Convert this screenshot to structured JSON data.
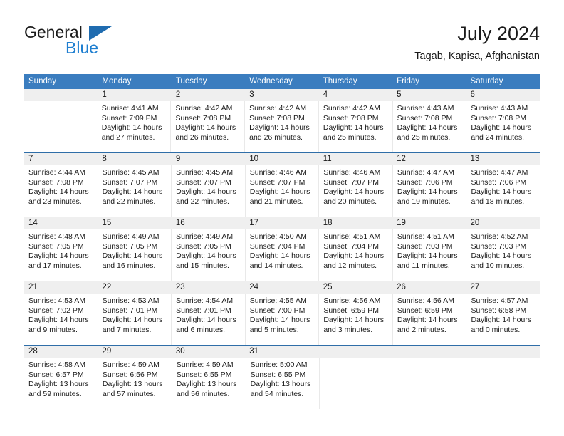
{
  "brand": {
    "name_dark": "General",
    "name_light": "Blue",
    "triangle_color": "#1f6cb0",
    "blue_text_color": "#1f7fd0"
  },
  "header": {
    "title": "July 2024",
    "subtitle": "Tagab, Kapisa, Afghanistan"
  },
  "theme": {
    "header_bg": "#3b7dbf",
    "header_text": "#ffffff",
    "daynum_bg": "#efefef",
    "separator": "#2f6ea8",
    "cell_border": "#e9e9e9"
  },
  "weekdays": [
    "Sunday",
    "Monday",
    "Tuesday",
    "Wednesday",
    "Thursday",
    "Friday",
    "Saturday"
  ],
  "weeks": [
    {
      "days": [
        {
          "num": "",
          "lines": []
        },
        {
          "num": "1",
          "lines": [
            "Sunrise: 4:41 AM",
            "Sunset: 7:09 PM",
            "Daylight: 14 hours",
            "and 27 minutes."
          ]
        },
        {
          "num": "2",
          "lines": [
            "Sunrise: 4:42 AM",
            "Sunset: 7:08 PM",
            "Daylight: 14 hours",
            "and 26 minutes."
          ]
        },
        {
          "num": "3",
          "lines": [
            "Sunrise: 4:42 AM",
            "Sunset: 7:08 PM",
            "Daylight: 14 hours",
            "and 26 minutes."
          ]
        },
        {
          "num": "4",
          "lines": [
            "Sunrise: 4:42 AM",
            "Sunset: 7:08 PM",
            "Daylight: 14 hours",
            "and 25 minutes."
          ]
        },
        {
          "num": "5",
          "lines": [
            "Sunrise: 4:43 AM",
            "Sunset: 7:08 PM",
            "Daylight: 14 hours",
            "and 25 minutes."
          ]
        },
        {
          "num": "6",
          "lines": [
            "Sunrise: 4:43 AM",
            "Sunset: 7:08 PM",
            "Daylight: 14 hours",
            "and 24 minutes."
          ]
        }
      ]
    },
    {
      "days": [
        {
          "num": "7",
          "lines": [
            "Sunrise: 4:44 AM",
            "Sunset: 7:08 PM",
            "Daylight: 14 hours",
            "and 23 minutes."
          ]
        },
        {
          "num": "8",
          "lines": [
            "Sunrise: 4:45 AM",
            "Sunset: 7:07 PM",
            "Daylight: 14 hours",
            "and 22 minutes."
          ]
        },
        {
          "num": "9",
          "lines": [
            "Sunrise: 4:45 AM",
            "Sunset: 7:07 PM",
            "Daylight: 14 hours",
            "and 22 minutes."
          ]
        },
        {
          "num": "10",
          "lines": [
            "Sunrise: 4:46 AM",
            "Sunset: 7:07 PM",
            "Daylight: 14 hours",
            "and 21 minutes."
          ]
        },
        {
          "num": "11",
          "lines": [
            "Sunrise: 4:46 AM",
            "Sunset: 7:07 PM",
            "Daylight: 14 hours",
            "and 20 minutes."
          ]
        },
        {
          "num": "12",
          "lines": [
            "Sunrise: 4:47 AM",
            "Sunset: 7:06 PM",
            "Daylight: 14 hours",
            "and 19 minutes."
          ]
        },
        {
          "num": "13",
          "lines": [
            "Sunrise: 4:47 AM",
            "Sunset: 7:06 PM",
            "Daylight: 14 hours",
            "and 18 minutes."
          ]
        }
      ]
    },
    {
      "days": [
        {
          "num": "14",
          "lines": [
            "Sunrise: 4:48 AM",
            "Sunset: 7:05 PM",
            "Daylight: 14 hours",
            "and 17 minutes."
          ]
        },
        {
          "num": "15",
          "lines": [
            "Sunrise: 4:49 AM",
            "Sunset: 7:05 PM",
            "Daylight: 14 hours",
            "and 16 minutes."
          ]
        },
        {
          "num": "16",
          "lines": [
            "Sunrise: 4:49 AM",
            "Sunset: 7:05 PM",
            "Daylight: 14 hours",
            "and 15 minutes."
          ]
        },
        {
          "num": "17",
          "lines": [
            "Sunrise: 4:50 AM",
            "Sunset: 7:04 PM",
            "Daylight: 14 hours",
            "and 14 minutes."
          ]
        },
        {
          "num": "18",
          "lines": [
            "Sunrise: 4:51 AM",
            "Sunset: 7:04 PM",
            "Daylight: 14 hours",
            "and 12 minutes."
          ]
        },
        {
          "num": "19",
          "lines": [
            "Sunrise: 4:51 AM",
            "Sunset: 7:03 PM",
            "Daylight: 14 hours",
            "and 11 minutes."
          ]
        },
        {
          "num": "20",
          "lines": [
            "Sunrise: 4:52 AM",
            "Sunset: 7:03 PM",
            "Daylight: 14 hours",
            "and 10 minutes."
          ]
        }
      ]
    },
    {
      "days": [
        {
          "num": "21",
          "lines": [
            "Sunrise: 4:53 AM",
            "Sunset: 7:02 PM",
            "Daylight: 14 hours",
            "and 9 minutes."
          ]
        },
        {
          "num": "22",
          "lines": [
            "Sunrise: 4:53 AM",
            "Sunset: 7:01 PM",
            "Daylight: 14 hours",
            "and 7 minutes."
          ]
        },
        {
          "num": "23",
          "lines": [
            "Sunrise: 4:54 AM",
            "Sunset: 7:01 PM",
            "Daylight: 14 hours",
            "and 6 minutes."
          ]
        },
        {
          "num": "24",
          "lines": [
            "Sunrise: 4:55 AM",
            "Sunset: 7:00 PM",
            "Daylight: 14 hours",
            "and 5 minutes."
          ]
        },
        {
          "num": "25",
          "lines": [
            "Sunrise: 4:56 AM",
            "Sunset: 6:59 PM",
            "Daylight: 14 hours",
            "and 3 minutes."
          ]
        },
        {
          "num": "26",
          "lines": [
            "Sunrise: 4:56 AM",
            "Sunset: 6:59 PM",
            "Daylight: 14 hours",
            "and 2 minutes."
          ]
        },
        {
          "num": "27",
          "lines": [
            "Sunrise: 4:57 AM",
            "Sunset: 6:58 PM",
            "Daylight: 14 hours",
            "and 0 minutes."
          ]
        }
      ]
    },
    {
      "days": [
        {
          "num": "28",
          "lines": [
            "Sunrise: 4:58 AM",
            "Sunset: 6:57 PM",
            "Daylight: 13 hours",
            "and 59 minutes."
          ]
        },
        {
          "num": "29",
          "lines": [
            "Sunrise: 4:59 AM",
            "Sunset: 6:56 PM",
            "Daylight: 13 hours",
            "and 57 minutes."
          ]
        },
        {
          "num": "30",
          "lines": [
            "Sunrise: 4:59 AM",
            "Sunset: 6:55 PM",
            "Daylight: 13 hours",
            "and 56 minutes."
          ]
        },
        {
          "num": "31",
          "lines": [
            "Sunrise: 5:00 AM",
            "Sunset: 6:55 PM",
            "Daylight: 13 hours",
            "and 54 minutes."
          ]
        },
        {
          "num": "",
          "lines": []
        },
        {
          "num": "",
          "lines": []
        },
        {
          "num": "",
          "lines": []
        }
      ]
    }
  ]
}
